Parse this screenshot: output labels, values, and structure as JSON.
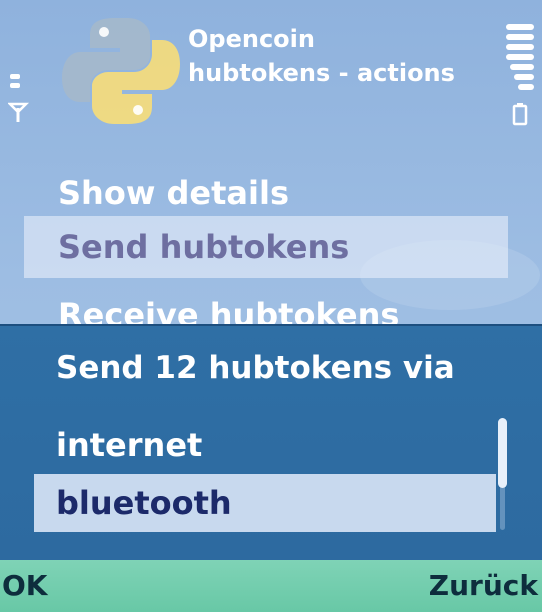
{
  "header": {
    "app_name": "Opencoin",
    "screen_title": "hubtokens - actions",
    "app_icon": "python-logo-icon"
  },
  "status": {
    "signal_icon": "signal-strength-icon",
    "battery_icon": "battery-level-icon"
  },
  "menu": {
    "items": [
      {
        "label": "Show details",
        "selected": false
      },
      {
        "label": "Send hubtokens",
        "selected": true
      },
      {
        "label": "Receive hubtokens",
        "selected": false
      }
    ]
  },
  "dialog": {
    "title": "Send 12 hubtokens via",
    "options": [
      {
        "label": "internet",
        "selected": false
      },
      {
        "label": "bluetooth",
        "selected": true
      }
    ]
  },
  "softkeys": {
    "left": "OK",
    "right": "Zurück"
  },
  "colors": {
    "background": "#9dbde3",
    "dialog": "#2f6fa5",
    "softkey_bar": "#74cdae",
    "selection_text": "#6e6fa1"
  }
}
